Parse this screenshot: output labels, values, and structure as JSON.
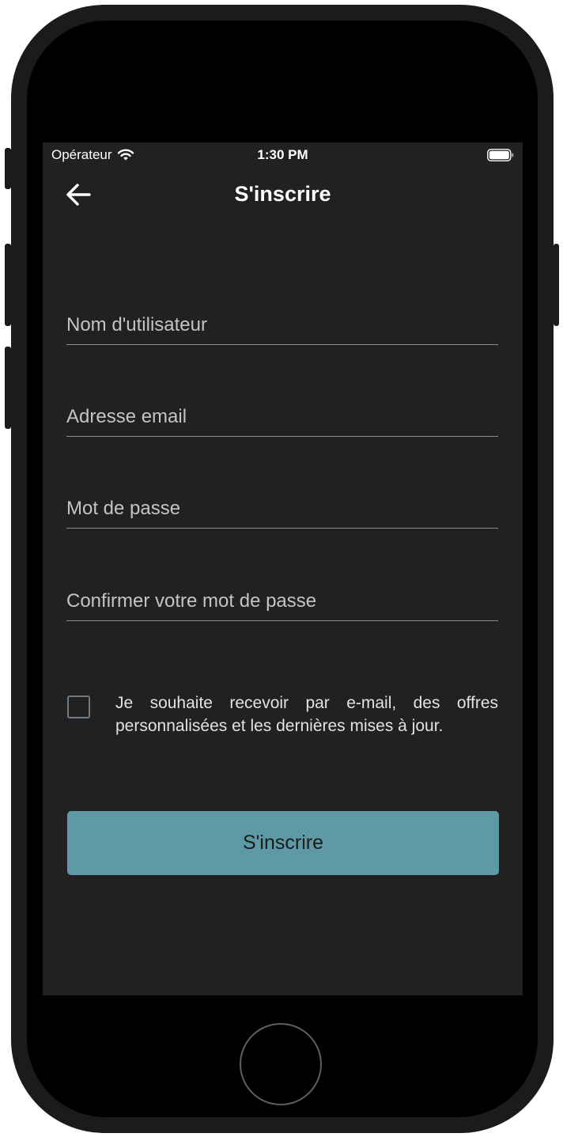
{
  "status_bar": {
    "carrier": "Opérateur",
    "time": "1:30 PM"
  },
  "nav": {
    "back_icon": "arrow-left-icon",
    "title": "S'inscrire"
  },
  "form": {
    "username_placeholder": "Nom d'utilisateur",
    "username_value": "",
    "email_placeholder": "Adresse email",
    "email_value": "",
    "password_placeholder": "Mot de passe",
    "password_value": "",
    "confirm_placeholder": "Confirmer votre mot de passe",
    "confirm_value": "",
    "newsletter_checked": false,
    "newsletter_label": "Je souhaite recevoir par e-mail, des offres personnalisées et les dernières mises à jour.",
    "submit_label": "S'inscrire"
  },
  "colors": {
    "screen_background": "#212121",
    "accent": "#5d9aa6",
    "placeholder_text": "#c4c4c4",
    "checkbox_border": "#6e7b86"
  }
}
